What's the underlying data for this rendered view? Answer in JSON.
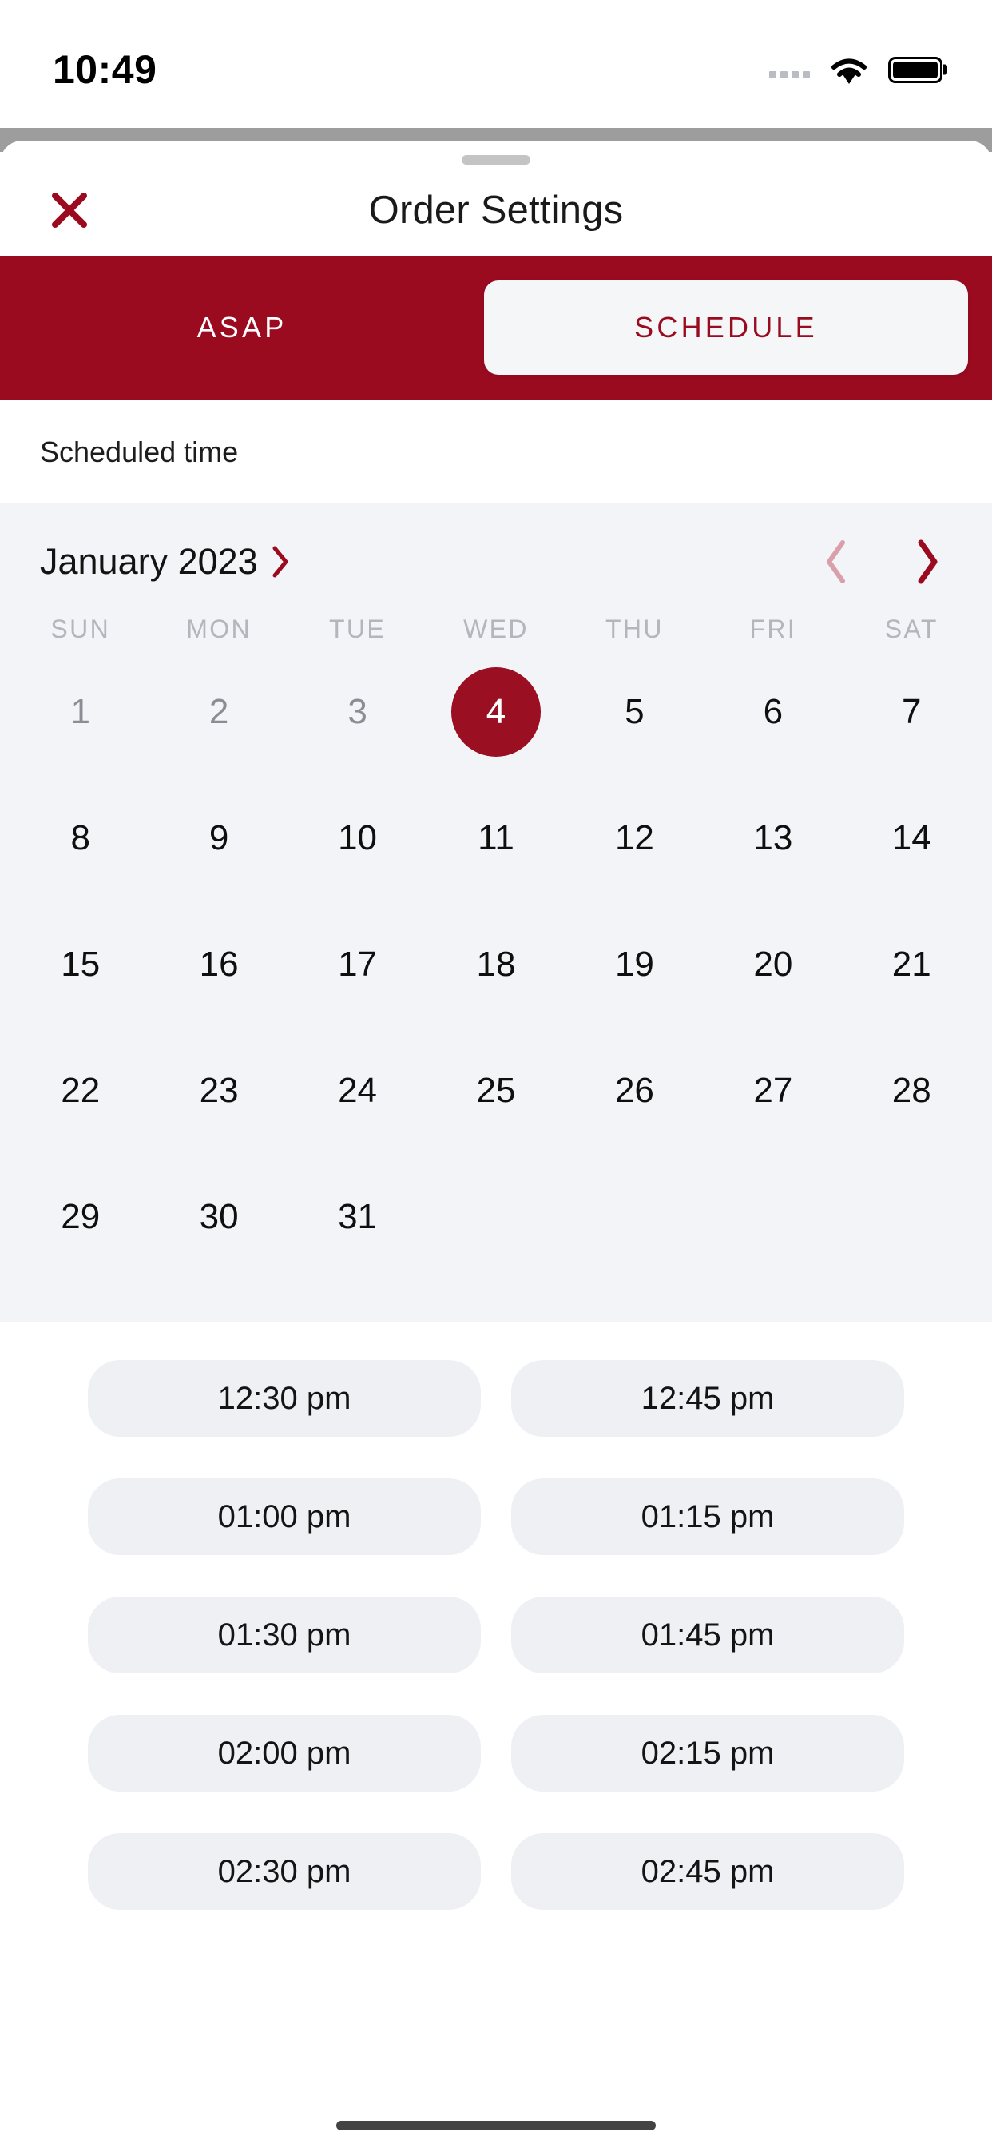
{
  "status_bar": {
    "time": "10:49",
    "signal_icon": "signal-dots-icon",
    "wifi_icon": "wifi-icon",
    "battery_icon": "battery-full-icon"
  },
  "sheet": {
    "grabber": "drag-handle",
    "close_icon": "close-x-icon",
    "title": "Order Settings"
  },
  "tabs": {
    "items": [
      {
        "label": "ASAP",
        "active": false
      },
      {
        "label": "SCHEDULE",
        "active": true
      }
    ],
    "active_index": 1,
    "bar_color": "#9A0B20",
    "active_pill_bg": "#f5f6f8",
    "active_text_color": "#9A0B20",
    "inactive_text_color": "#ffffff"
  },
  "scheduled": {
    "label": "Scheduled time"
  },
  "calendar": {
    "month_label": "January 2023",
    "month_expand_icon": "chevron-right-icon",
    "prev_icon": "chevron-left-icon",
    "next_icon": "chevron-right-icon",
    "prev_enabled": false,
    "next_enabled": true,
    "background": "#f3f4f8",
    "accent": "#9A1022",
    "weekdays": [
      "SUN",
      "MON",
      "TUE",
      "WED",
      "THU",
      "FRI",
      "SAT"
    ],
    "selected_day": 4,
    "disabled_days": [
      1,
      2,
      3
    ],
    "weeks": [
      [
        "1",
        "2",
        "3",
        "4",
        "5",
        "6",
        "7"
      ],
      [
        "8",
        "9",
        "10",
        "11",
        "12",
        "13",
        "14"
      ],
      [
        "15",
        "16",
        "17",
        "18",
        "19",
        "20",
        "21"
      ],
      [
        "22",
        "23",
        "24",
        "25",
        "26",
        "27",
        "28"
      ],
      [
        "29",
        "30",
        "31",
        "",
        "",
        "",
        ""
      ]
    ]
  },
  "time_slots": {
    "items": [
      "12:30 pm",
      "12:45 pm",
      "01:00 pm",
      "01:15 pm",
      "01:30 pm",
      "01:45 pm",
      "02:00 pm",
      "02:15 pm",
      "02:30 pm",
      "02:45 pm"
    ],
    "pill_bg": "#eef0f4"
  }
}
